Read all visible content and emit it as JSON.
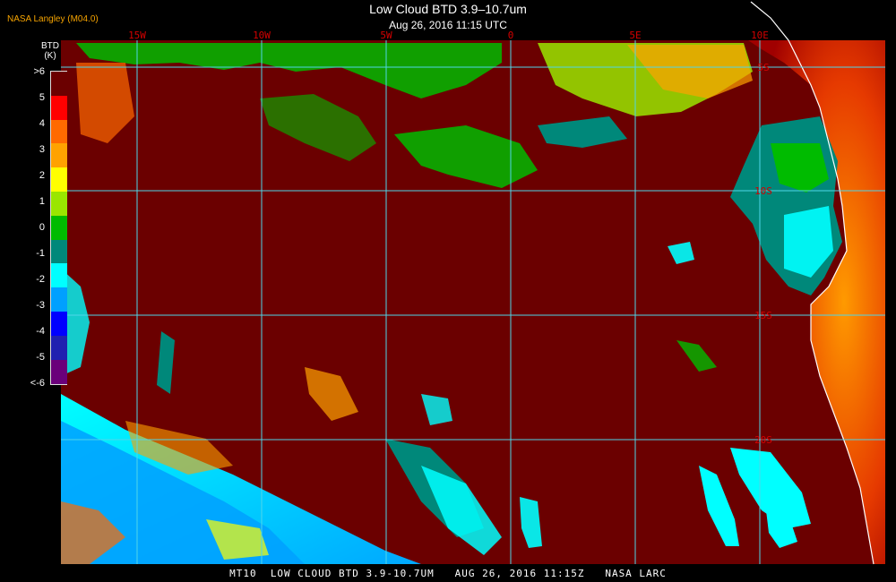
{
  "header": {
    "title": "Low Cloud BTD 3.9–10.7um",
    "timestamp": "Aug 26, 2016 11:15 UTC",
    "provider": "NASA Langley (M04.0)"
  },
  "legend": {
    "title_line1": "BTD",
    "title_line2": "(K)",
    "labels": [
      ">6",
      "5",
      "4",
      "3",
      "2",
      "1",
      "0",
      "-1",
      "-2",
      "-3",
      "-4",
      "-5",
      "<-6"
    ],
    "colors": [
      "#6b0000",
      "#ff0000",
      "#ff6a00",
      "#ffa200",
      "#ffff00",
      "#9ae600",
      "#00bb00",
      "#00887a",
      "#00ffff",
      "#00a0ff",
      "#0000ff",
      "#2020b0",
      "#6a007a"
    ]
  },
  "grid": {
    "lon_labels": [
      "15W",
      "10W",
      "5W",
      "0",
      "5E",
      "10E"
    ],
    "lat_labels": [
      "5S",
      "10S",
      "15S",
      "20S"
    ],
    "line_color": "#4fd6e8",
    "label_color": "#d40000"
  },
  "colors": {
    "background": "#000000",
    "no_cloud": "#6b0000",
    "land": "#cc1a00",
    "coast": "#ffffff"
  },
  "footer": {
    "text": "MT10  LOW CLOUD BTD 3.9-10.7UM   AUG 26, 2016 11:15Z   NASA LARC"
  }
}
